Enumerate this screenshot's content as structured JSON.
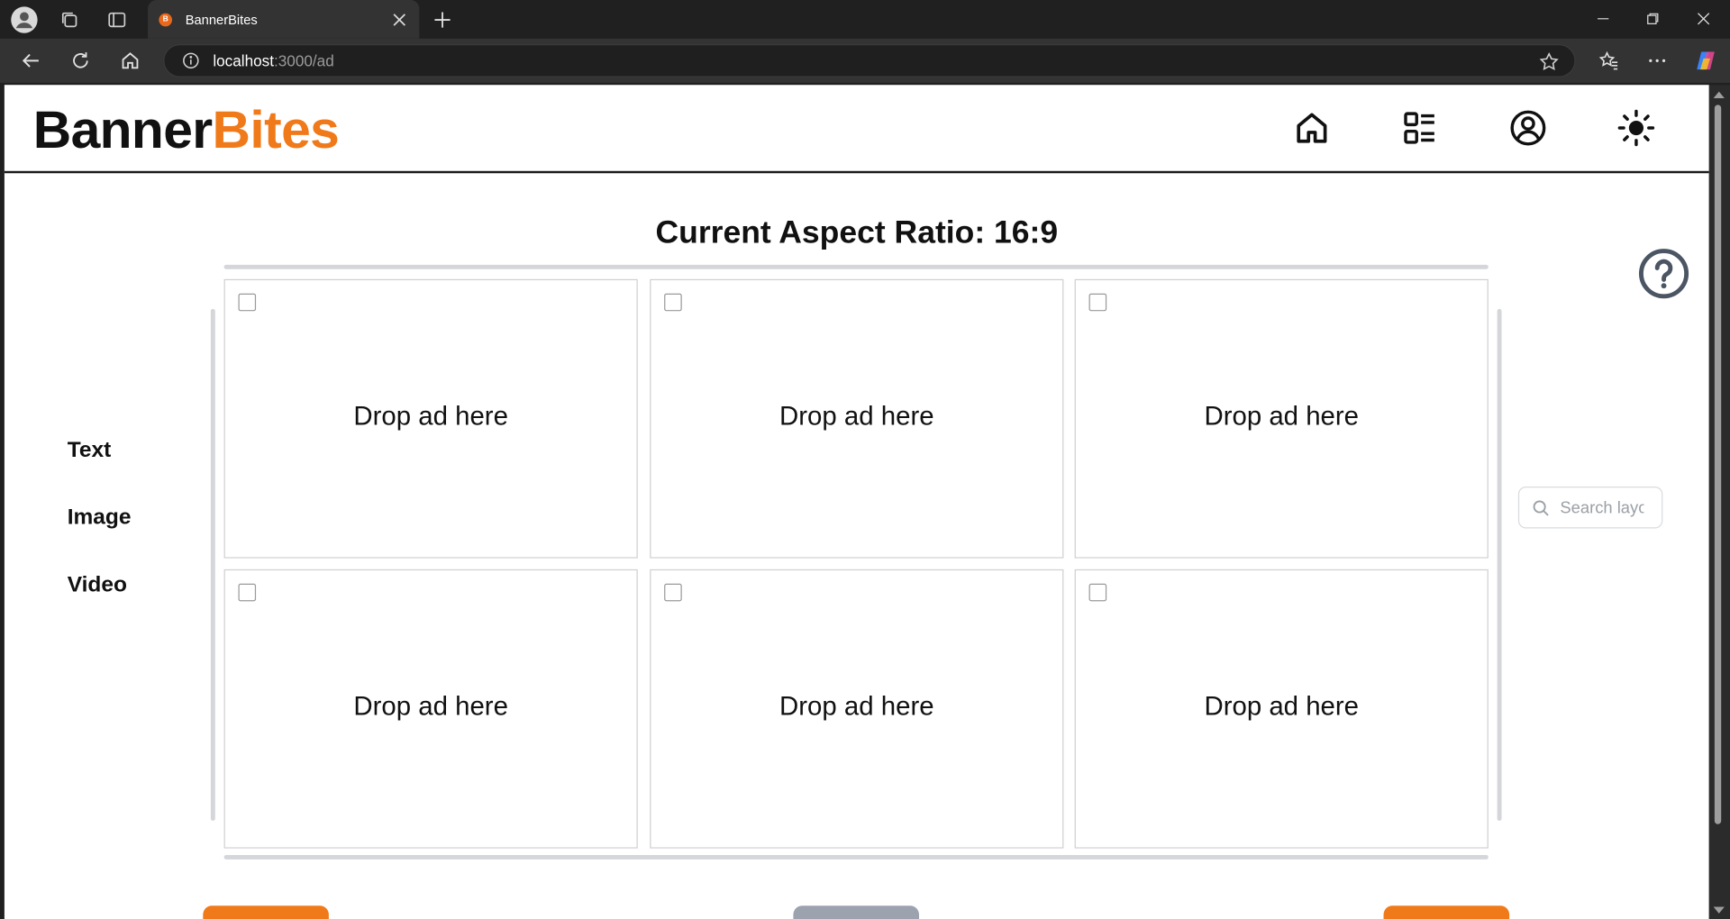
{
  "browser": {
    "tab_title": "BannerBites",
    "url_host": "localhost",
    "url_path": ":3000/ad"
  },
  "app": {
    "logo_part1": "Banner",
    "logo_part2": "Bites",
    "brand_color": "#f07a1a",
    "title": "Current Aspect Ratio: 16:9"
  },
  "sidebar": {
    "items": [
      {
        "label": "Text"
      },
      {
        "label": "Image"
      },
      {
        "label": "Video"
      }
    ]
  },
  "grid": {
    "cells": [
      {
        "label": "Drop ad here"
      },
      {
        "label": "Drop ad here"
      },
      {
        "label": "Drop ad here"
      },
      {
        "label": "Drop ad here"
      },
      {
        "label": "Drop ad here"
      },
      {
        "label": "Drop ad here"
      }
    ]
  },
  "search": {
    "placeholder": "Search layouts"
  },
  "colors": {
    "accent": "#f07a1a",
    "neutral_button": "#9ca3af"
  }
}
